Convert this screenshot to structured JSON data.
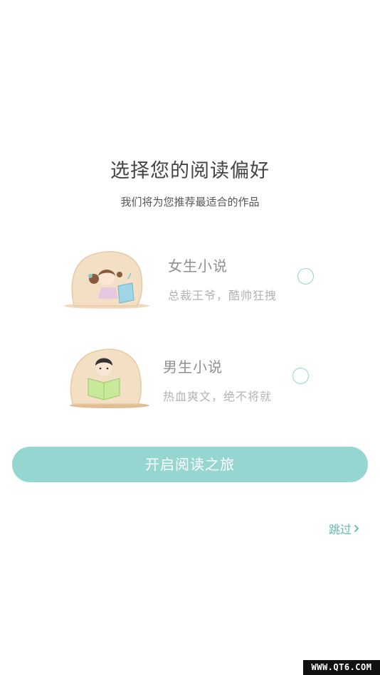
{
  "header": {
    "title": "选择您的阅读偏好",
    "subtitle": "我们将为您推荐最适合的作品"
  },
  "options": [
    {
      "title": "女生小说",
      "description": "总裁王爷，酷帅狂拽",
      "selected": false
    },
    {
      "title": "男生小说",
      "description": "热血爽文，绝不将就",
      "selected": false
    }
  ],
  "start_button": {
    "label": "开启阅读之旅"
  },
  "skip": {
    "label": "跳过",
    "icon": "chevron-right-icon"
  },
  "watermark": {
    "text": "WWW.QT6.COM"
  },
  "colors": {
    "accent": "#96d6d1",
    "skip_text": "#5cb8b2",
    "illustration_bg": "#f1ddc0"
  }
}
